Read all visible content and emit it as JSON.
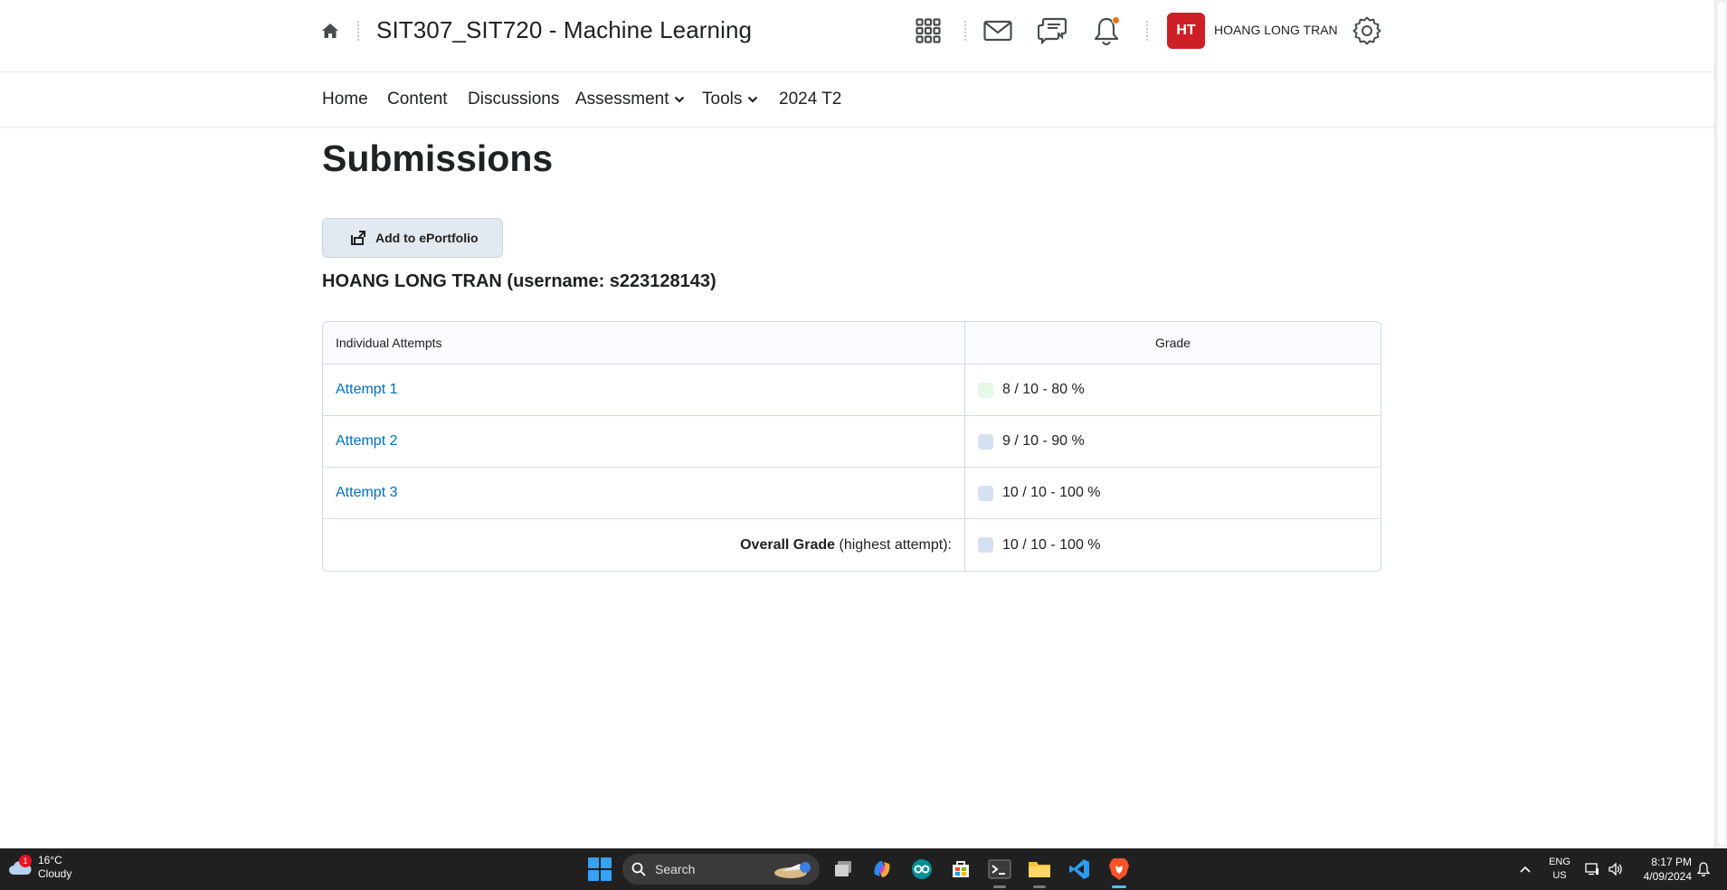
{
  "header": {
    "course_title": "SIT307_SIT720 - Machine Learning",
    "user_initials": "HT",
    "user_name": "HOANG LONG TRAN",
    "icons": [
      "home-icon",
      "waffle-grid-icon",
      "mail-icon",
      "discussion-icon",
      "bell-icon",
      "gear-icon"
    ],
    "accent_color": "#cd2026",
    "notification_dot_color": "#e87511"
  },
  "nav": {
    "home": "Home",
    "content": "Content",
    "discussions": "Discussions",
    "assessment": "Assessment",
    "tools": "Tools",
    "term": "2024 T2"
  },
  "main": {
    "title": "Submissions",
    "eportfolio_label": "Add to ePortfolio",
    "user_heading": "HOANG LONG TRAN (username: s223128143)",
    "table": {
      "col_attempts": "Individual Attempts",
      "col_grade": "Grade",
      "rows": [
        {
          "label": "Attempt 1",
          "grade": "8 / 10 - 80 %",
          "swatch": "#e6f9e6"
        },
        {
          "label": "Attempt 2",
          "grade": "9 / 10 - 90 %",
          "swatch": "#d5e1f0"
        },
        {
          "label": "Attempt 3",
          "grade": "10 / 10 - 100 %",
          "swatch": "#d5e1f0"
        }
      ],
      "overall_bold": "Overall Grade",
      "overall_rest": " (highest attempt):",
      "overall_grade": "10 / 10 - 100 %",
      "overall_swatch": "#d5e1f0"
    }
  },
  "taskbar": {
    "weather_temp": "16°C",
    "weather_desc": "Cloudy",
    "weather_badge": "1",
    "search_label": "Search",
    "lang_top": "ENG",
    "lang_bottom": "US",
    "time": "8:17 PM",
    "date": "4/09/2024"
  }
}
